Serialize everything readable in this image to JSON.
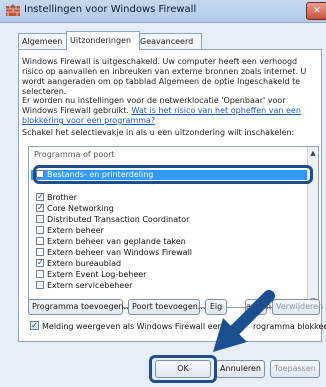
{
  "window": {
    "title": "Instellingen voor Windows Firewall",
    "close_label": "✕"
  },
  "tabs": [
    {
      "label": "Algemeen",
      "active": false
    },
    {
      "label": "Uitzonderingen",
      "active": true
    },
    {
      "label": "Geavanceerd",
      "active": false
    }
  ],
  "text": {
    "para1": "Windows Firewall is uitgeschakeld. Uw computer heeft een verhoogd risico op aanvallen en inbreuken van externe bronnen zoals internet. U wordt aangeraden om op tabblad Algemeen de optie Ingeschakeld te selecteren.",
    "para2_prefix": "Er worden nu instellingen voor de netwerklocatie 'Openbaar' voor Windows Firewall gebruikt. ",
    "para2_link": "Wat is het risico van het opheffen van een blokkering voor een programma?",
    "para3": "Schakel het selectievakje in als u een uitzondering wilt inschakelen:"
  },
  "list": {
    "header": "Programma of poort",
    "items": [
      {
        "label": "Bestands- en printerdeling",
        "checked": false,
        "selected": true
      },
      {
        "label": "Brother",
        "checked": true,
        "selected": false
      },
      {
        "label": "Core Networking",
        "checked": true,
        "selected": false
      },
      {
        "label": "Distributed Transaction Coordinator",
        "checked": false,
        "selected": false
      },
      {
        "label": "Extern beheer",
        "checked": false,
        "selected": false
      },
      {
        "label": "Extern beheer van geplande taken",
        "checked": false,
        "selected": false
      },
      {
        "label": "Extern beheer van Windows Firewall",
        "checked": false,
        "selected": false
      },
      {
        "label": "Extern bureaublad",
        "checked": true,
        "selected": false
      },
      {
        "label": "Extern Event Log-beheer",
        "checked": false,
        "selected": false
      },
      {
        "label": "Extern servicebeheer",
        "checked": false,
        "selected": false
      }
    ]
  },
  "buttons": {
    "add_program": "Programma toevoegen...",
    "add_port": "Poort toevoegen...",
    "properties_partial": "Eig",
    "properties_partial2": "appen",
    "delete": "Verwijderen",
    "ok": "OK",
    "cancel": "Annuleren",
    "apply": "Toepassen"
  },
  "notify": {
    "label_part1": "Melding weergeven als Windows Firewall een",
    "label_part2": "rogramma blokkeert",
    "checked": true
  },
  "colors": {
    "highlight": "#1b4f8f",
    "selection": "#3399ff",
    "link": "#1b56c6"
  }
}
